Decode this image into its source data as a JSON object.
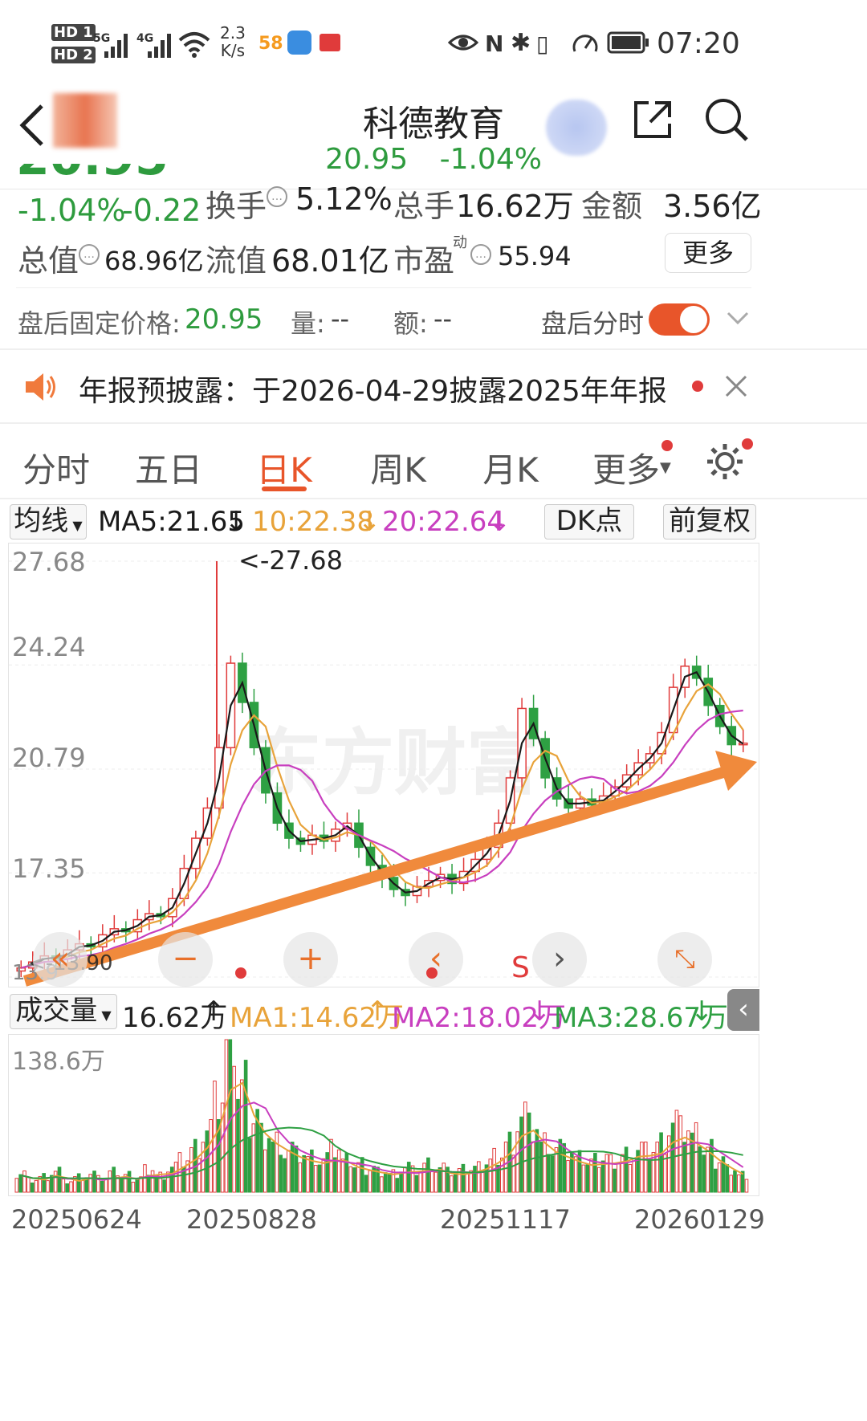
{
  "status_bar": {
    "hd1": "HD 1",
    "hd2": "HD 2",
    "net5g": "5G",
    "net4g": "4G",
    "speed_value": "2.3",
    "speed_unit": "K/s",
    "app58": "58",
    "time": "07:20"
  },
  "header": {
    "title": "科德教育",
    "price": "20.95",
    "change_pct": "-1.04%"
  },
  "quote": {
    "change_pct": "-1.04%",
    "change_abs": "-0.22",
    "turnover_label": "换手",
    "turnover_value": "5.12%",
    "volume_label": "总手",
    "volume_value": "16.62万",
    "amount_label": "金额",
    "amount_value": "3.56亿",
    "total_cap_label": "总值",
    "total_cap_value": "68.96亿",
    "float_cap_label": "流值",
    "float_cap_value": "68.01亿",
    "pe_label": "市盈",
    "pe_sup": "动",
    "pe_value": "55.94",
    "more_label": "更多"
  },
  "after_hours": {
    "price_label": "盘后固定价格:",
    "price_value": "20.95",
    "vol_label": "量:",
    "vol_value": "--",
    "amt_label": "额:",
    "amt_value": "--",
    "toggle_label": "盘后分时",
    "toggle_on": true
  },
  "notice": {
    "text": "年报预披露：于2026-04-29披露2025年年报"
  },
  "tabs": [
    "分时",
    "五日",
    "日K",
    "周K",
    "月K",
    "更多"
  ],
  "active_tab": 2,
  "kline_bar": {
    "ma_selector": "均线",
    "ma5": "MA5:21.65",
    "ma10": "10:22.38",
    "ma20": "20:22.64",
    "dk_label": "DK点",
    "adjust_label": "前复权"
  },
  "kline": {
    "y_labels": [
      "27.68",
      "24.24",
      "20.79",
      "17.35",
      "13.9"
    ],
    "max_marker": "<-27.68",
    "left_overlay_text": "<-13.90",
    "s_marker": "S",
    "watermark": "东方财富"
  },
  "volume_bar": {
    "selector": "成交量",
    "value": "16.62万",
    "ma1": "MA1:14.62万",
    "ma2": "MA2:18.02万",
    "ma3": "MA3:28.67万",
    "y_label": "138.6万"
  },
  "x_labels": [
    "20250624",
    "20250828",
    "20251117",
    "20260129"
  ],
  "colors": {
    "up": "#e03b3b",
    "down": "#2ea043",
    "ma5": "#1a1a1a",
    "ma10": "#e8a33a",
    "ma20": "#c83fbf",
    "accent": "#e8552a",
    "arrow": "#f08a3c",
    "green_text": "#2e9b3e"
  },
  "chart_data": [
    {
      "type": "candlestick",
      "title": "",
      "ylim": [
        13.9,
        27.68
      ],
      "y_ticks": [
        27.68,
        24.24,
        20.79,
        17.35,
        13.9
      ],
      "x_ticks": [
        "20250624",
        "20250828",
        "20251117",
        "20260129"
      ],
      "series": [
        {
          "name": "MA5",
          "last": 21.65
        },
        {
          "name": "MA10",
          "last": 22.38
        },
        {
          "name": "MA20",
          "last": 22.64
        }
      ],
      "price_path": [
        14.2,
        14.4,
        14.6,
        14.5,
        14.8,
        15.0,
        14.9,
        15.3,
        15.5,
        15.4,
        15.8,
        16.0,
        15.9,
        16.5,
        17.5,
        18.5,
        19.5,
        21.5,
        24.3,
        23.0,
        21.5,
        20.0,
        19.0,
        18.5,
        18.3,
        18.6,
        18.4,
        18.8,
        19.0,
        18.2,
        17.6,
        17.2,
        16.8,
        16.6,
        16.9,
        17.1,
        17.3,
        17.0,
        17.4,
        17.8,
        18.2,
        19.0,
        20.5,
        22.8,
        21.8,
        20.5,
        19.8,
        19.5,
        19.8,
        19.6,
        19.9,
        20.2,
        20.6,
        21.0,
        21.3,
        22.0,
        23.5,
        24.2,
        23.8,
        22.9,
        22.2,
        21.6,
        21.65
      ],
      "max_price": 27.68
    },
    {
      "type": "bar",
      "title": "",
      "ylim": [
        0,
        138.6
      ],
      "y_unit": "万",
      "volume_path": [
        18,
        12,
        15,
        20,
        10,
        14,
        16,
        12,
        18,
        15,
        13,
        22,
        16,
        24,
        30,
        40,
        55,
        80,
        138.6,
        95,
        70,
        55,
        48,
        40,
        35,
        32,
        30,
        38,
        28,
        25,
        22,
        20,
        18,
        24,
        20,
        26,
        22,
        18,
        20,
        22,
        28,
        35,
        48,
        72,
        60,
        45,
        40,
        35,
        30,
        28,
        32,
        30,
        36,
        40,
        38,
        45,
        62,
        55,
        50,
        38,
        30,
        22,
        16.62
      ]
    }
  ]
}
